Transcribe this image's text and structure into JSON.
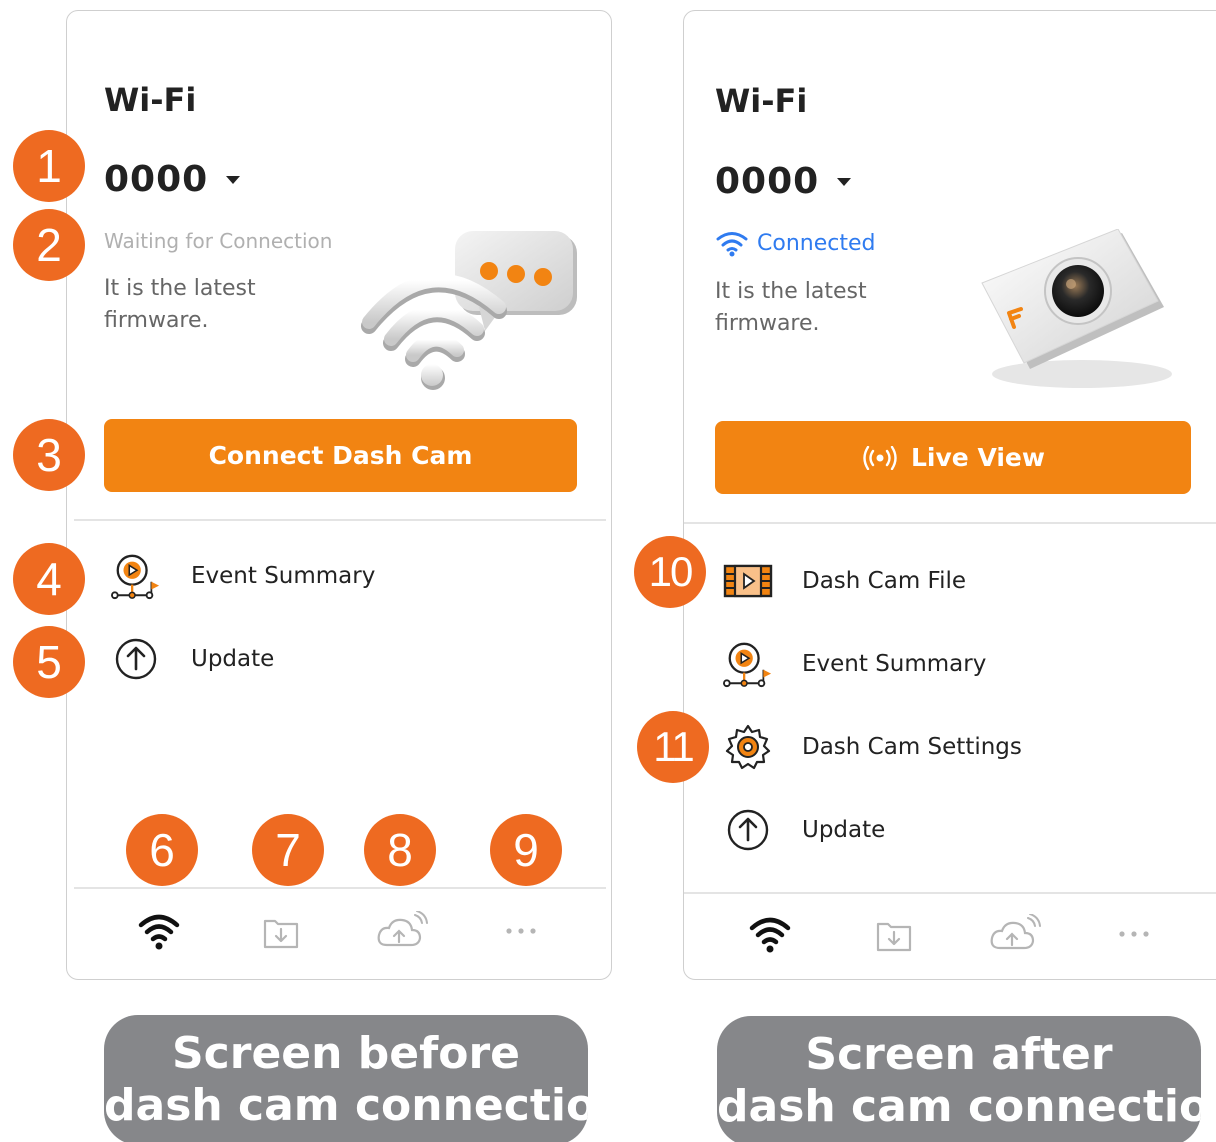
{
  "before": {
    "title": "Wi-Fi",
    "ssid": "0000",
    "status": "Waiting for Connection",
    "firmware_line1": "It is the latest",
    "firmware_line2": "firmware.",
    "primary_button": "Connect Dash Cam",
    "menu": [
      {
        "label": "Event Summary",
        "icon": "event-summary-icon"
      },
      {
        "label": "Update",
        "icon": "update-icon"
      }
    ],
    "tabs": [
      "wifi-tab-icon",
      "download-tab-icon",
      "cloud-tab-icon",
      "more-tab-icon"
    ],
    "caption_line1": "Screen before",
    "caption_line2": "dash cam connection"
  },
  "after": {
    "title": "Wi-Fi",
    "ssid": "0000",
    "status": "Connected",
    "firmware_line1": "It is the latest",
    "firmware_line2": "firmware.",
    "primary_button": "Live View",
    "menu": [
      {
        "label": "Dash Cam File",
        "icon": "film-file-icon"
      },
      {
        "label": "Event Summary",
        "icon": "event-summary-icon"
      },
      {
        "label": "Dash Cam Settings",
        "icon": "settings-gear-icon"
      },
      {
        "label": "Update",
        "icon": "update-icon"
      }
    ],
    "tabs": [
      "wifi-tab-icon",
      "download-tab-icon",
      "cloud-tab-icon",
      "more-tab-icon"
    ],
    "caption_line1": "Screen after",
    "caption_line2": "dash cam connection"
  },
  "callouts": [
    "1",
    "2",
    "3",
    "4",
    "5",
    "6",
    "7",
    "8",
    "9",
    "10",
    "11"
  ],
  "colors": {
    "accent": "#f28412",
    "callout": "#ee6a21",
    "connected": "#2f7bf0",
    "caption_bg": "#86878a",
    "inactive_tab": "#b5b5b5"
  }
}
